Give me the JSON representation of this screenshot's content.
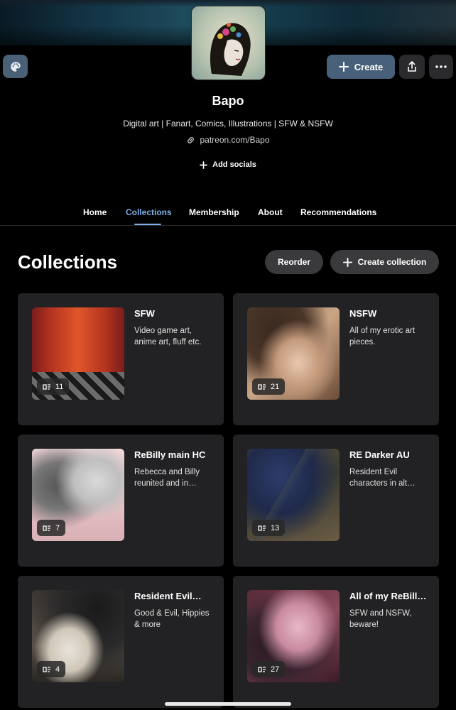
{
  "creator": {
    "name": "Bapo",
    "tagline": "Digital art | Fanart, Comics, Illustrations | SFW & NSFW",
    "link": "patreon.com/Bapo",
    "add_socials": "Add socials"
  },
  "header": {
    "create_label": "Create",
    "theme_icon": "palette-icon",
    "share_icon": "share-icon",
    "more_icon": "more-icon"
  },
  "tabs": [
    {
      "label": "Home",
      "active": false
    },
    {
      "label": "Collections",
      "active": true
    },
    {
      "label": "Membership",
      "active": false
    },
    {
      "label": "About",
      "active": false
    },
    {
      "label": "Recommendations",
      "active": false
    }
  ],
  "collections_section": {
    "title": "Collections",
    "reorder_label": "Reorder",
    "create_collection_label": "Create collection"
  },
  "collections": [
    {
      "title": "SFW",
      "description": "Video game art, anime art, fluff etc.",
      "count": "11"
    },
    {
      "title": "NSFW",
      "description": "All of my erotic art pieces.",
      "count": "21"
    },
    {
      "title": "ReBilly main HC",
      "description": "Rebecca and Billy reunited and in…",
      "count": "7"
    },
    {
      "title": "RE Darker AU",
      "description": "Resident Evil characters in alt…",
      "count": "13"
    },
    {
      "title": "Resident Evil…",
      "description": "Good & Evil, Hippies & more",
      "count": "4"
    },
    {
      "title": "All of my ReBill…",
      "description": "SFW and NSFW, beware!",
      "count": "27"
    }
  ],
  "colors": {
    "accent": "#7fb0e8",
    "create_button": "#48607a",
    "card_bg": "#222224"
  }
}
